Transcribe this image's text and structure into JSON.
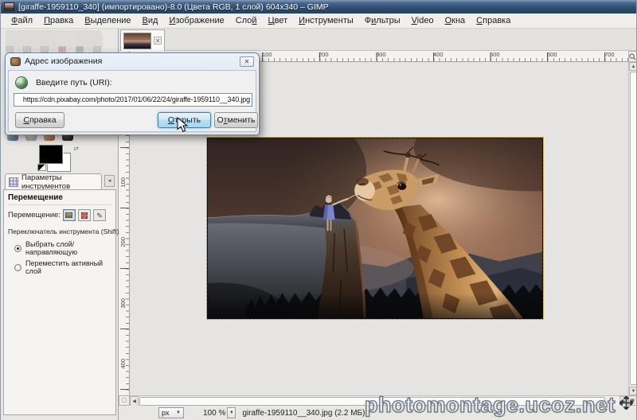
{
  "window": {
    "title": "[giraffe-1959110_340] (импортировано)-8.0 (Цвета RGB, 1 слой) 604x340 – GIMP"
  },
  "menu": {
    "items": [
      "Файл",
      "Правка",
      "Выделение",
      "Вид",
      "Изображение",
      "Слой",
      "Цвет",
      "Инструменты",
      "Фильтры",
      "Video",
      "Окна",
      "Справка"
    ]
  },
  "image_tab": {
    "close_icon": "✕"
  },
  "dialog": {
    "title": "Адрес изображения",
    "close_icon": "✕",
    "prompt": "Введите путь (URI):",
    "uri_value": "https://cdn.pixabay.com/photo/2017/01/06/22/24/giraffe-1959110__340.jpg",
    "help_button": "Справка",
    "open_button": "Открыть",
    "cancel_button": "Отменить"
  },
  "toolbox": {
    "foreground_color": "#000000",
    "background_color": "#ffffff",
    "swap_icon": "⇄"
  },
  "tool_options": {
    "tab_label": "Параметры инструментов",
    "side_button": "◂",
    "tool_title": "Перемещение",
    "move_label": "Перемещение:",
    "path_mode_icon": "✎",
    "switch_label": "Переключатель инструмента  (Shift)",
    "radio_select_layer": "Выбрать слой/направляющую",
    "radio_move_active": "Переместить активный слой"
  },
  "rulers": {
    "h": [
      "100",
      "200",
      "300",
      "400",
      "500",
      "600",
      "700"
    ],
    "v": [
      "100",
      "200",
      "300",
      "400"
    ]
  },
  "scrollbar": {
    "up": "▲",
    "down": "▼",
    "left": "◀",
    "right": "▶"
  },
  "status_bar": {
    "unit": "px",
    "dropdown_icon": "▼",
    "zoom_level": "100 %",
    "file_info": "giraffe-1959110__340.jpg (2.2 МБ)"
  },
  "watermark": {
    "text": "photomontage.ucoz.net"
  },
  "colors": {
    "focus_button_border": "#3c7fb1",
    "titlebar_blue": "#2f4e72",
    "canvas_surround": "#e5e4e2",
    "layer_boundary_yellow": "#c7b35e"
  }
}
